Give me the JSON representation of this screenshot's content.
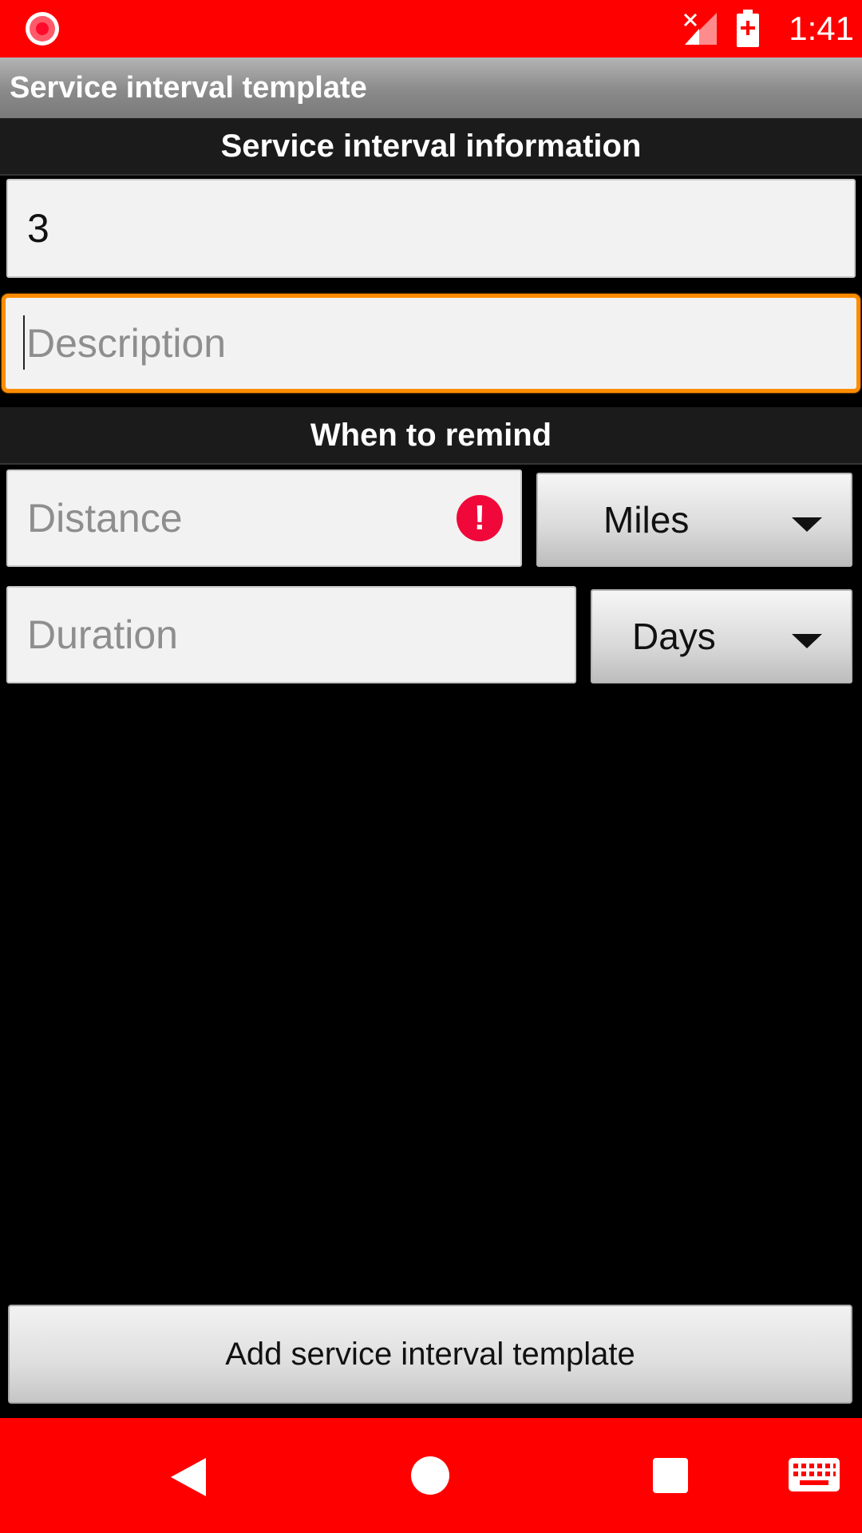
{
  "status_bar": {
    "time": "1:41",
    "icons": [
      "screen-record-icon",
      "no-signal-icon",
      "battery-charging-icon"
    ],
    "color": "#ff0000"
  },
  "action_bar": {
    "title": "Service interval template"
  },
  "sections": {
    "info_header": "Service interval information",
    "remind_header": "When to remind"
  },
  "form": {
    "name_value": "3",
    "description_placeholder": "Description",
    "distance_placeholder": "Distance",
    "distance_unit": "Miles",
    "duration_placeholder": "Duration",
    "duration_unit": "Days"
  },
  "add_button_label": "Add service interval template",
  "nav_bar": {
    "buttons": [
      "back-icon",
      "home-icon",
      "recent-apps-icon",
      "keyboard-icon"
    ]
  },
  "colors": {
    "accent": "#ff0000",
    "focus": "#ff8c00",
    "error": "#f0083a"
  }
}
